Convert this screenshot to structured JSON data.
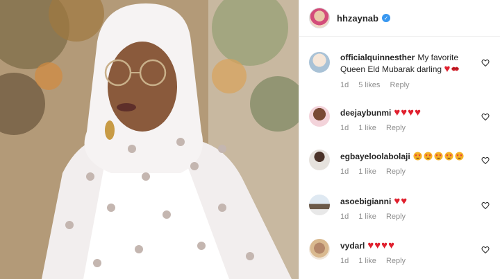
{
  "post": {
    "author": "hhzaynab",
    "verified": true
  },
  "colors": {
    "heart": "#e0202e",
    "verified": "#3897f0",
    "meta_text": "#8e8e8e"
  },
  "comments": [
    {
      "username": "officialquinnesther",
      "text": "My favorite Queen Eld Mubarak darling",
      "emojis": [
        "red-heart",
        "kiss-mark"
      ],
      "time": "1d",
      "likes": "5 likes",
      "reply": "Reply"
    },
    {
      "username": "deejaybunmi",
      "text": "",
      "emojis": [
        "red-heart",
        "red-heart",
        "red-heart",
        "red-heart"
      ],
      "time": "1d",
      "likes": "1 like",
      "reply": "Reply"
    },
    {
      "username": "egbayeloolabolaji",
      "text": "",
      "emojis": [
        "star-struck",
        "star-struck",
        "star-struck",
        "star-struck",
        "star-struck"
      ],
      "time": "1d",
      "likes": "1 like",
      "reply": "Reply"
    },
    {
      "username": "asoebigianni",
      "text": "",
      "emojis": [
        "red-heart",
        "red-heart"
      ],
      "time": "1d",
      "likes": "1 like",
      "reply": "Reply"
    },
    {
      "username": "vydarl",
      "text": "",
      "emojis": [
        "red-heart",
        "red-heart",
        "red-heart",
        "red-heart"
      ],
      "time": "1d",
      "likes": "1 like",
      "reply": "Reply"
    }
  ]
}
